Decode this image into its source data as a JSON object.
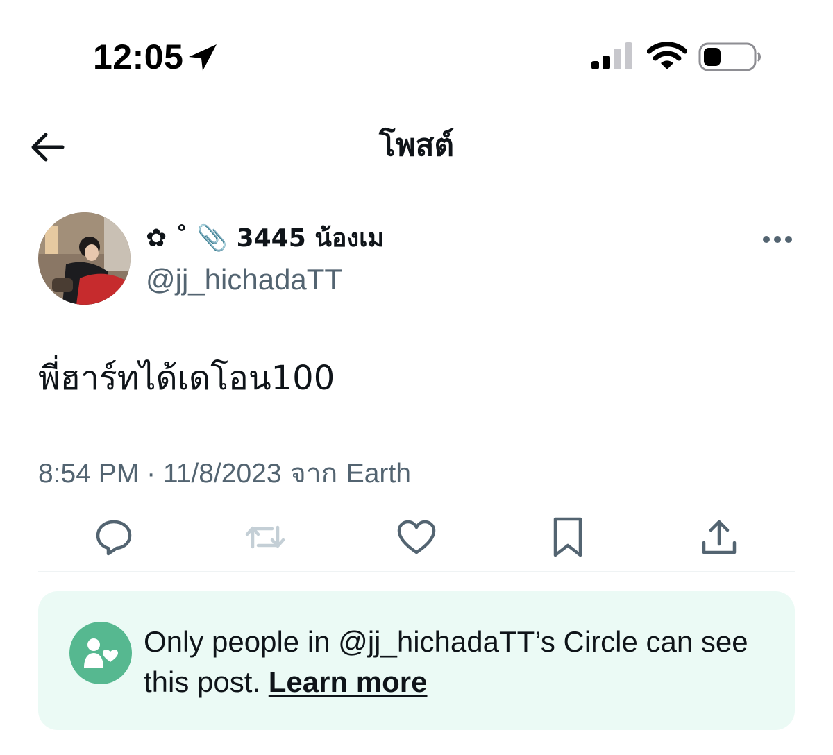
{
  "status_bar": {
    "time": "12:05",
    "icons": [
      "location-arrow-icon",
      "cellular-signal-icon",
      "wifi-icon",
      "battery-low-icon"
    ]
  },
  "header": {
    "title": "โพสต์",
    "back_icon": "arrow-left-icon"
  },
  "post": {
    "author": {
      "display_name": "✿ ˚ 📎 3445 น้องเม",
      "handle": "@jj_hichadaTT"
    },
    "text": "พี่ฮาร์ทได้เดโอน100",
    "time": "8:54 PM",
    "separator": " · ",
    "date": "11/8/2023",
    "source_prefix": " จาก ",
    "source": "Earth",
    "actions": [
      "reply-icon",
      "repost-icon",
      "like-icon",
      "bookmark-icon",
      "share-icon"
    ]
  },
  "circle_notice": {
    "text": "Only people in @jj_hichadaTT’s Circle can see this post. ",
    "link": "Learn more",
    "icon": "circle-people-heart-icon"
  },
  "colors": {
    "text_primary": "#0f1419",
    "text_secondary": "#536471",
    "circle_bg": "#ebfaf5",
    "circle_badge": "#56b890",
    "repost_disabled": "#c4cfd6"
  }
}
